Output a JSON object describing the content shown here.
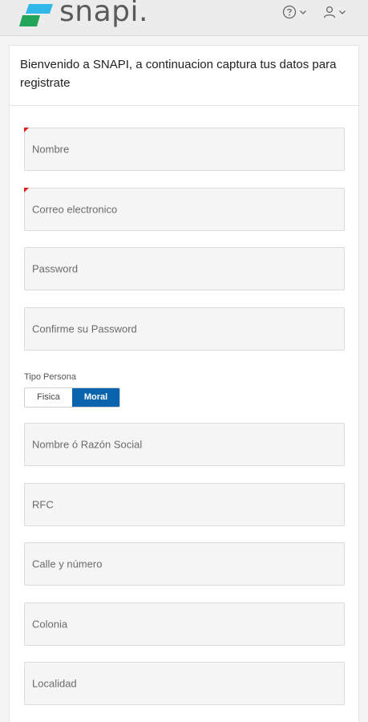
{
  "header": {
    "logo_text": "snapi.",
    "logo_colors": [
      "#2fb8e8",
      "#22a55a"
    ],
    "help_icon": "help-circle-icon",
    "user_icon": "user-icon",
    "dropdown_icon": "chevron-down-icon"
  },
  "form": {
    "welcome": "Bienvenido a SNAPI, a continuacion captura tus datos para registrate",
    "fields_top": [
      {
        "placeholder": "Nombre",
        "required": true
      },
      {
        "placeholder": "Correo electronico",
        "required": true
      },
      {
        "placeholder": "Password",
        "required": false
      },
      {
        "placeholder": "Confirme su Password",
        "required": false
      }
    ],
    "tipo_persona": {
      "label": "Tipo Persona",
      "options": [
        "Fisica",
        "Moral"
      ],
      "selected": "Moral"
    },
    "fields_bottom": [
      {
        "placeholder": "Nombre ó Razón Social"
      },
      {
        "placeholder": "RFC"
      },
      {
        "placeholder": "Calle y número"
      },
      {
        "placeholder": "Colonia"
      },
      {
        "placeholder": "Localidad"
      }
    ],
    "accent_color": "#0a64ad",
    "required_marker_color": "#e0201b"
  }
}
